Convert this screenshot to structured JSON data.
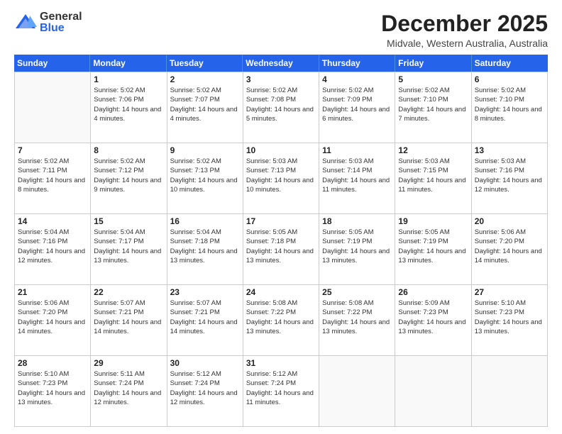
{
  "logo": {
    "general": "General",
    "blue": "Blue"
  },
  "title": "December 2025",
  "location": "Midvale, Western Australia, Australia",
  "days_of_week": [
    "Sunday",
    "Monday",
    "Tuesday",
    "Wednesday",
    "Thursday",
    "Friday",
    "Saturday"
  ],
  "weeks": [
    [
      {
        "day": "",
        "sunrise": "",
        "sunset": "",
        "daylight": ""
      },
      {
        "day": "1",
        "sunrise": "Sunrise: 5:02 AM",
        "sunset": "Sunset: 7:06 PM",
        "daylight": "Daylight: 14 hours and 4 minutes."
      },
      {
        "day": "2",
        "sunrise": "Sunrise: 5:02 AM",
        "sunset": "Sunset: 7:07 PM",
        "daylight": "Daylight: 14 hours and 4 minutes."
      },
      {
        "day": "3",
        "sunrise": "Sunrise: 5:02 AM",
        "sunset": "Sunset: 7:08 PM",
        "daylight": "Daylight: 14 hours and 5 minutes."
      },
      {
        "day": "4",
        "sunrise": "Sunrise: 5:02 AM",
        "sunset": "Sunset: 7:09 PM",
        "daylight": "Daylight: 14 hours and 6 minutes."
      },
      {
        "day": "5",
        "sunrise": "Sunrise: 5:02 AM",
        "sunset": "Sunset: 7:10 PM",
        "daylight": "Daylight: 14 hours and 7 minutes."
      },
      {
        "day": "6",
        "sunrise": "Sunrise: 5:02 AM",
        "sunset": "Sunset: 7:10 PM",
        "daylight": "Daylight: 14 hours and 8 minutes."
      }
    ],
    [
      {
        "day": "7",
        "sunrise": "Sunrise: 5:02 AM",
        "sunset": "Sunset: 7:11 PM",
        "daylight": "Daylight: 14 hours and 8 minutes."
      },
      {
        "day": "8",
        "sunrise": "Sunrise: 5:02 AM",
        "sunset": "Sunset: 7:12 PM",
        "daylight": "Daylight: 14 hours and 9 minutes."
      },
      {
        "day": "9",
        "sunrise": "Sunrise: 5:02 AM",
        "sunset": "Sunset: 7:13 PM",
        "daylight": "Daylight: 14 hours and 10 minutes."
      },
      {
        "day": "10",
        "sunrise": "Sunrise: 5:03 AM",
        "sunset": "Sunset: 7:13 PM",
        "daylight": "Daylight: 14 hours and 10 minutes."
      },
      {
        "day": "11",
        "sunrise": "Sunrise: 5:03 AM",
        "sunset": "Sunset: 7:14 PM",
        "daylight": "Daylight: 14 hours and 11 minutes."
      },
      {
        "day": "12",
        "sunrise": "Sunrise: 5:03 AM",
        "sunset": "Sunset: 7:15 PM",
        "daylight": "Daylight: 14 hours and 11 minutes."
      },
      {
        "day": "13",
        "sunrise": "Sunrise: 5:03 AM",
        "sunset": "Sunset: 7:16 PM",
        "daylight": "Daylight: 14 hours and 12 minutes."
      }
    ],
    [
      {
        "day": "14",
        "sunrise": "Sunrise: 5:04 AM",
        "sunset": "Sunset: 7:16 PM",
        "daylight": "Daylight: 14 hours and 12 minutes."
      },
      {
        "day": "15",
        "sunrise": "Sunrise: 5:04 AM",
        "sunset": "Sunset: 7:17 PM",
        "daylight": "Daylight: 14 hours and 13 minutes."
      },
      {
        "day": "16",
        "sunrise": "Sunrise: 5:04 AM",
        "sunset": "Sunset: 7:18 PM",
        "daylight": "Daylight: 14 hours and 13 minutes."
      },
      {
        "day": "17",
        "sunrise": "Sunrise: 5:05 AM",
        "sunset": "Sunset: 7:18 PM",
        "daylight": "Daylight: 14 hours and 13 minutes."
      },
      {
        "day": "18",
        "sunrise": "Sunrise: 5:05 AM",
        "sunset": "Sunset: 7:19 PM",
        "daylight": "Daylight: 14 hours and 13 minutes."
      },
      {
        "day": "19",
        "sunrise": "Sunrise: 5:05 AM",
        "sunset": "Sunset: 7:19 PM",
        "daylight": "Daylight: 14 hours and 13 minutes."
      },
      {
        "day": "20",
        "sunrise": "Sunrise: 5:06 AM",
        "sunset": "Sunset: 7:20 PM",
        "daylight": "Daylight: 14 hours and 14 minutes."
      }
    ],
    [
      {
        "day": "21",
        "sunrise": "Sunrise: 5:06 AM",
        "sunset": "Sunset: 7:20 PM",
        "daylight": "Daylight: 14 hours and 14 minutes."
      },
      {
        "day": "22",
        "sunrise": "Sunrise: 5:07 AM",
        "sunset": "Sunset: 7:21 PM",
        "daylight": "Daylight: 14 hours and 14 minutes."
      },
      {
        "day": "23",
        "sunrise": "Sunrise: 5:07 AM",
        "sunset": "Sunset: 7:21 PM",
        "daylight": "Daylight: 14 hours and 14 minutes."
      },
      {
        "day": "24",
        "sunrise": "Sunrise: 5:08 AM",
        "sunset": "Sunset: 7:22 PM",
        "daylight": "Daylight: 14 hours and 13 minutes."
      },
      {
        "day": "25",
        "sunrise": "Sunrise: 5:08 AM",
        "sunset": "Sunset: 7:22 PM",
        "daylight": "Daylight: 14 hours and 13 minutes."
      },
      {
        "day": "26",
        "sunrise": "Sunrise: 5:09 AM",
        "sunset": "Sunset: 7:23 PM",
        "daylight": "Daylight: 14 hours and 13 minutes."
      },
      {
        "day": "27",
        "sunrise": "Sunrise: 5:10 AM",
        "sunset": "Sunset: 7:23 PM",
        "daylight": "Daylight: 14 hours and 13 minutes."
      }
    ],
    [
      {
        "day": "28",
        "sunrise": "Sunrise: 5:10 AM",
        "sunset": "Sunset: 7:23 PM",
        "daylight": "Daylight: 14 hours and 13 minutes."
      },
      {
        "day": "29",
        "sunrise": "Sunrise: 5:11 AM",
        "sunset": "Sunset: 7:24 PM",
        "daylight": "Daylight: 14 hours and 12 minutes."
      },
      {
        "day": "30",
        "sunrise": "Sunrise: 5:12 AM",
        "sunset": "Sunset: 7:24 PM",
        "daylight": "Daylight: 14 hours and 12 minutes."
      },
      {
        "day": "31",
        "sunrise": "Sunrise: 5:12 AM",
        "sunset": "Sunset: 7:24 PM",
        "daylight": "Daylight: 14 hours and 11 minutes."
      },
      {
        "day": "",
        "sunrise": "",
        "sunset": "",
        "daylight": ""
      },
      {
        "day": "",
        "sunrise": "",
        "sunset": "",
        "daylight": ""
      },
      {
        "day": "",
        "sunrise": "",
        "sunset": "",
        "daylight": ""
      }
    ]
  ]
}
